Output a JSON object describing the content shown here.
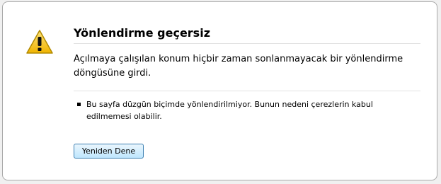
{
  "error": {
    "title": "Yönlendirme geçersiz",
    "description": "Açılmaya çalışılan konum hiçbir zaman sonlanmayacak bir yönlendirme döngüsüne girdi.",
    "details": [
      "Bu sayfa düzgün biçimde yönlendirilmiyor. Bunun nedeni çerezlerin kabul edilmemesi olabilir."
    ],
    "retry_label": "Yeniden Dene",
    "icon": "warning-icon"
  },
  "colors": {
    "warning_fill": "#f6c80e",
    "button_border": "#3c7fb1"
  }
}
